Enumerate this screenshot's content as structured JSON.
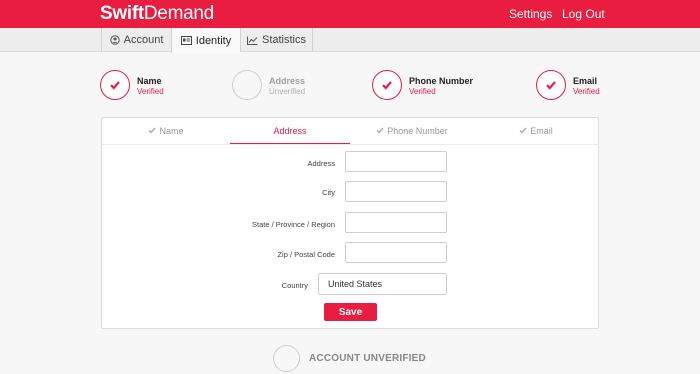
{
  "brand": {
    "part1": "Swift",
    "part2": "Demand",
    "accent": "#e81d3f"
  },
  "topnav": {
    "settings": "Settings",
    "logout": "Log Out"
  },
  "tabs": [
    {
      "label": "Account",
      "icon": "user-circle-icon"
    },
    {
      "label": "Identity",
      "icon": "id-card-icon",
      "active": true
    },
    {
      "label": "Statistics",
      "icon": "line-chart-icon"
    }
  ],
  "steps": [
    {
      "title": "Name",
      "status": "Verified",
      "verified": true
    },
    {
      "title": "Address",
      "status": "Unverified",
      "verified": false
    },
    {
      "title": "Phone Number",
      "status": "Verified",
      "verified": true
    },
    {
      "title": "Email",
      "status": "Verified",
      "verified": true
    }
  ],
  "form_tabs": [
    {
      "label": "Name",
      "checked": true
    },
    {
      "label": "Address",
      "active": true
    },
    {
      "label": "Phone Number",
      "checked": true
    },
    {
      "label": "Email",
      "checked": true
    }
  ],
  "form": {
    "fields": [
      {
        "label": "Address",
        "value": ""
      },
      {
        "label": "City",
        "value": ""
      },
      {
        "label": "State / Province / Region",
        "value": ""
      },
      {
        "label": "Zip / Postal Code",
        "value": ""
      }
    ],
    "country": {
      "label": "Country",
      "value": "United States"
    },
    "save_label": "Save"
  },
  "footer": {
    "status": "ACCOUNT UNVERIFIED"
  }
}
